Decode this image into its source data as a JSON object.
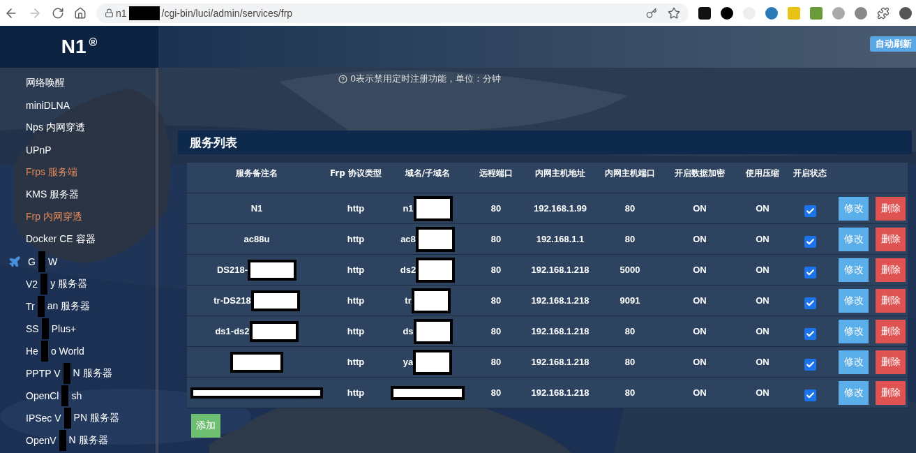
{
  "browser": {
    "url_parts": [
      "n1",
      "/cgi-bin/luci/admin/services/frp"
    ]
  },
  "header": {
    "logo": "N1",
    "logo_mark": "®",
    "refresh_button": "自动刷新"
  },
  "sidebar": {
    "items": [
      {
        "parts": [
          "网络唤醒"
        ],
        "selected": false
      },
      {
        "parts": [
          "miniDLNA"
        ],
        "selected": false
      },
      {
        "parts": [
          "Nps 内网穿透"
        ],
        "selected": false
      },
      {
        "parts": [
          "UPnP"
        ],
        "selected": false
      },
      {
        "parts": [
          "Frps 服务端"
        ],
        "selected": true
      },
      {
        "parts": [
          "KMS 服务器"
        ],
        "selected": false
      },
      {
        "parts": [
          "Frp 内网穿透"
        ],
        "selected": true
      },
      {
        "parts": [
          "Docker CE 容器"
        ],
        "selected": false
      },
      {
        "parts": [
          "G",
          "W"
        ],
        "selected": false,
        "kind": "group"
      },
      {
        "parts": [
          "V2",
          "y 服务器"
        ],
        "selected": false
      },
      {
        "parts": [
          "Tr",
          "an 服务器"
        ],
        "selected": false
      },
      {
        "parts": [
          "SS",
          "Plus+"
        ],
        "selected": false
      },
      {
        "parts": [
          "He",
          "o World"
        ],
        "selected": false
      },
      {
        "parts": [
          "PPTP V",
          "N 服务器"
        ],
        "selected": false
      },
      {
        "parts": [
          "OpenCl",
          "sh"
        ],
        "selected": false
      },
      {
        "parts": [
          "IPSec V",
          "PN 服务器"
        ],
        "selected": false
      },
      {
        "parts": [
          "OpenV",
          "N 服务器"
        ],
        "selected": false
      }
    ]
  },
  "hint": "0表示禁用定时注册功能，单位：分钟",
  "section_title": "服务列表",
  "table": {
    "columns": [
      "服务备注名",
      "Frp 协议类型",
      "域名/子域名",
      "远程端口",
      "内网主机地址",
      "内网主机端口",
      "开启数据加密",
      "使用压缩",
      "开启状态"
    ],
    "rows": [
      {
        "name": "N1",
        "type": "http",
        "domain": "n1",
        "remote_port": "80",
        "host": "192.168.1.99",
        "port": "80",
        "encrypt": "ON",
        "compress": "ON",
        "enabled": true
      },
      {
        "name": "ac88u",
        "type": "http",
        "domain": "ac8",
        "remote_port": "80",
        "host": "192.168.1.1",
        "port": "80",
        "encrypt": "ON",
        "compress": "ON",
        "enabled": true
      },
      {
        "name": "DS218-",
        "type": "http",
        "domain": "ds2",
        "remote_port": "80",
        "host": "192.168.1.218",
        "port": "5000",
        "encrypt": "ON",
        "compress": "ON",
        "enabled": true
      },
      {
        "name": "tr-DS218",
        "type": "http",
        "domain": "tr",
        "remote_port": "80",
        "host": "192.168.1.218",
        "port": "9091",
        "encrypt": "ON",
        "compress": "ON",
        "enabled": true
      },
      {
        "name": "ds1-ds2",
        "type": "http",
        "domain": "ds",
        "remote_port": "80",
        "host": "192.168.1.218",
        "port": "80",
        "encrypt": "ON",
        "compress": "ON",
        "enabled": true
      },
      {
        "type": "http",
        "domain": "ya",
        "remote_port": "80",
        "host": "192.168.1.218",
        "port": "80",
        "encrypt": "ON",
        "compress": "ON",
        "enabled": true
      },
      {
        "type": "http",
        "remote_port": "80",
        "host": "192.168.1.218",
        "port": "80",
        "encrypt": "ON",
        "compress": "ON",
        "enabled": true
      }
    ],
    "edit_labels": [
      "修改",
      "修改",
      "修改",
      "修改",
      "修改",
      "修改",
      "修改"
    ],
    "delete_labels": [
      "删除",
      "删除",
      "删除",
      "删除",
      "删除",
      "删除",
      "删除"
    ]
  },
  "add_button": "添加"
}
